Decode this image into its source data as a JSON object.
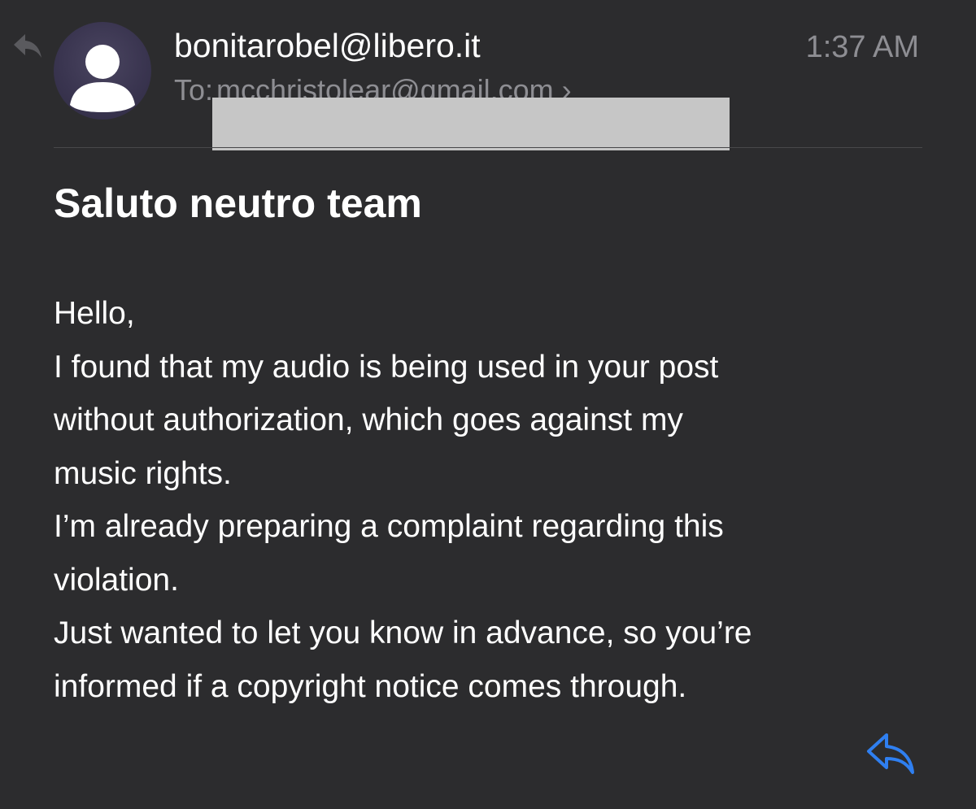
{
  "message": {
    "sender": "bonitarobel@libero.it",
    "time": "1:37 AM",
    "to_label": "To:",
    "recipient": "mcchristolear@gmail.com",
    "recipient_chevron": "›",
    "subject": "Saluto neutro team",
    "body_lines": [
      "Hello,",
      "I found that my audio is being used in your post",
      "without authorization, which goes against my",
      "music rights.",
      "I’m already preparing a complaint regarding this",
      "violation.",
      "Just wanted to let you know in advance, so you’re",
      "informed if a copyright notice comes through."
    ]
  },
  "icons": {
    "replied_indicator": "reply-arrow-icon",
    "avatar": "person-silhouette-icon",
    "reply_action": "reply-arrow-icon"
  },
  "colors": {
    "background": "#2c2c2e",
    "text_primary": "#ffffff",
    "text_secondary": "#8e8e93",
    "accent": "#2f7ff0",
    "redaction": "#c6c6c6"
  }
}
